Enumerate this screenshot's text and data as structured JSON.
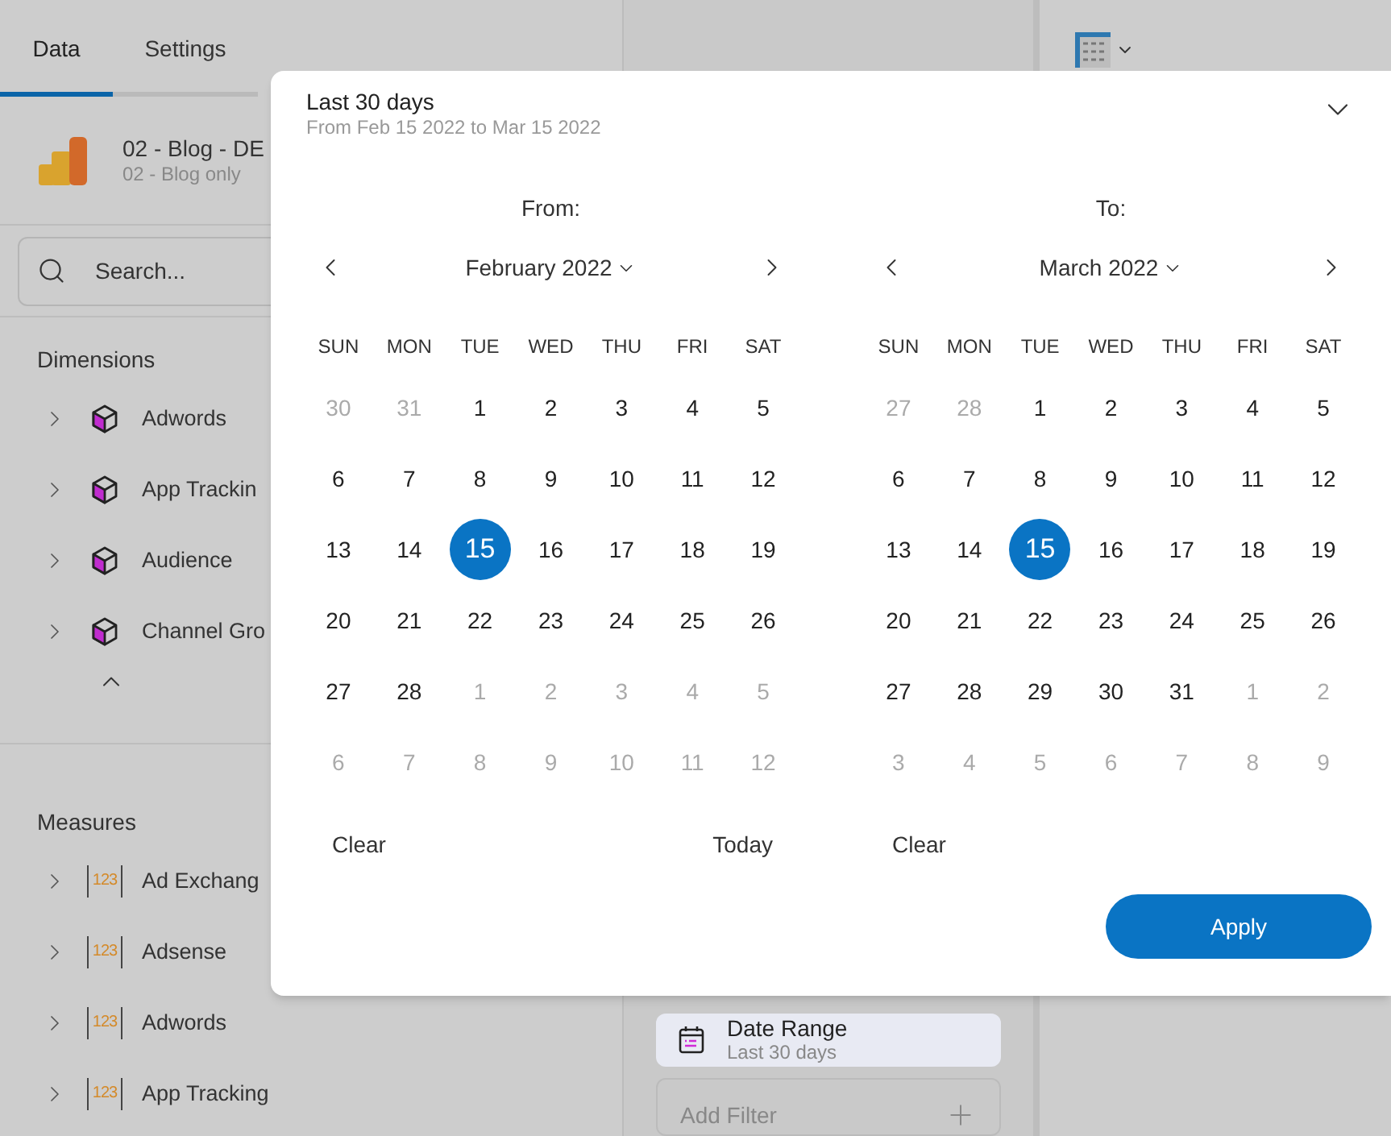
{
  "tabs": [
    {
      "label": "Data",
      "selected": true
    },
    {
      "label": "Settings",
      "selected": false
    }
  ],
  "source": {
    "name": "02 - Blog - DE",
    "subtitle": "02 - Blog only"
  },
  "search": {
    "placeholder": "Search..."
  },
  "sections": [
    {
      "title": "Dimensions",
      "kind": "dimension",
      "items": [
        {
          "label": "Adwords"
        },
        {
          "label": "App Trackin"
        },
        {
          "label": "Audience"
        },
        {
          "label": "Channel Gro"
        }
      ]
    },
    {
      "title": "Measures",
      "kind": "measure",
      "items": [
        {
          "label": "Ad Exchang",
          "icon_label": "123"
        },
        {
          "label": "Adsense",
          "icon_label": "123"
        },
        {
          "label": "Adwords",
          "icon_label": "123"
        },
        {
          "label": "App Tracking",
          "icon_label": "123"
        }
      ]
    }
  ],
  "filters": [
    {
      "kind": "date",
      "title": "Date Range",
      "subtitle": "Last 30 days",
      "selected": true
    },
    {
      "kind": "add",
      "placeholder": "Add Filter",
      "selected": false
    }
  ],
  "popup": {
    "title": "Last 30 days",
    "subtitle": "From Feb 15 2022 to Mar 15 2022",
    "calendars": [
      {
        "label": "From:",
        "month": "February 2022",
        "weekdays": [
          "SUN",
          "MON",
          "TUE",
          "WED",
          "THU",
          "FRI",
          "SAT"
        ],
        "buttons": [
          "Clear",
          "Today"
        ],
        "weeks": [
          [
            {
              "d": "30",
              "muted": true,
              "selected": false
            },
            {
              "d": "31",
              "muted": true,
              "selected": false
            },
            {
              "d": "1",
              "muted": false,
              "selected": false
            },
            {
              "d": "2",
              "muted": false,
              "selected": false
            },
            {
              "d": "3",
              "muted": false,
              "selected": false
            },
            {
              "d": "4",
              "muted": false,
              "selected": false
            },
            {
              "d": "5",
              "muted": false,
              "selected": false
            }
          ],
          [
            {
              "d": "6",
              "muted": false,
              "selected": false
            },
            {
              "d": "7",
              "muted": false,
              "selected": false
            },
            {
              "d": "8",
              "muted": false,
              "selected": false
            },
            {
              "d": "9",
              "muted": false,
              "selected": false
            },
            {
              "d": "10",
              "muted": false,
              "selected": false
            },
            {
              "d": "11",
              "muted": false,
              "selected": false
            },
            {
              "d": "12",
              "muted": false,
              "selected": false
            }
          ],
          [
            {
              "d": "13",
              "muted": false,
              "selected": false
            },
            {
              "d": "14",
              "muted": false,
              "selected": false
            },
            {
              "d": "15",
              "muted": false,
              "selected": true
            },
            {
              "d": "16",
              "muted": false,
              "selected": false
            },
            {
              "d": "17",
              "muted": false,
              "selected": false
            },
            {
              "d": "18",
              "muted": false,
              "selected": false
            },
            {
              "d": "19",
              "muted": false,
              "selected": false
            }
          ],
          [
            {
              "d": "20",
              "muted": false,
              "selected": false
            },
            {
              "d": "21",
              "muted": false,
              "selected": false
            },
            {
              "d": "22",
              "muted": false,
              "selected": false
            },
            {
              "d": "23",
              "muted": false,
              "selected": false
            },
            {
              "d": "24",
              "muted": false,
              "selected": false
            },
            {
              "d": "25",
              "muted": false,
              "selected": false
            },
            {
              "d": "26",
              "muted": false,
              "selected": false
            }
          ],
          [
            {
              "d": "27",
              "muted": false,
              "selected": false
            },
            {
              "d": "28",
              "muted": false,
              "selected": false
            },
            {
              "d": "1",
              "muted": true,
              "selected": false
            },
            {
              "d": "2",
              "muted": true,
              "selected": false
            },
            {
              "d": "3",
              "muted": true,
              "selected": false
            },
            {
              "d": "4",
              "muted": true,
              "selected": false
            },
            {
              "d": "5",
              "muted": true,
              "selected": false
            }
          ],
          [
            {
              "d": "6",
              "muted": true,
              "selected": false
            },
            {
              "d": "7",
              "muted": true,
              "selected": false
            },
            {
              "d": "8",
              "muted": true,
              "selected": false
            },
            {
              "d": "9",
              "muted": true,
              "selected": false
            },
            {
              "d": "10",
              "muted": true,
              "selected": false
            },
            {
              "d": "11",
              "muted": true,
              "selected": false
            },
            {
              "d": "12",
              "muted": true,
              "selected": false
            }
          ]
        ]
      },
      {
        "label": "To:",
        "month": "March 2022",
        "weekdays": [
          "SUN",
          "MON",
          "TUE",
          "WED",
          "THU",
          "FRI",
          "SAT"
        ],
        "buttons": [
          "Clear"
        ],
        "weeks": [
          [
            {
              "d": "27",
              "muted": true,
              "selected": false
            },
            {
              "d": "28",
              "muted": true,
              "selected": false
            },
            {
              "d": "1",
              "muted": false,
              "selected": false
            },
            {
              "d": "2",
              "muted": false,
              "selected": false
            },
            {
              "d": "3",
              "muted": false,
              "selected": false
            },
            {
              "d": "4",
              "muted": false,
              "selected": false
            },
            {
              "d": "5",
              "muted": false,
              "selected": false
            }
          ],
          [
            {
              "d": "6",
              "muted": false,
              "selected": false
            },
            {
              "d": "7",
              "muted": false,
              "selected": false
            },
            {
              "d": "8",
              "muted": false,
              "selected": false
            },
            {
              "d": "9",
              "muted": false,
              "selected": false
            },
            {
              "d": "10",
              "muted": false,
              "selected": false
            },
            {
              "d": "11",
              "muted": false,
              "selected": false
            },
            {
              "d": "12",
              "muted": false,
              "selected": false
            }
          ],
          [
            {
              "d": "13",
              "muted": false,
              "selected": false
            },
            {
              "d": "14",
              "muted": false,
              "selected": false
            },
            {
              "d": "15",
              "muted": false,
              "selected": true
            },
            {
              "d": "16",
              "muted": false,
              "selected": false
            },
            {
              "d": "17",
              "muted": false,
              "selected": false
            },
            {
              "d": "18",
              "muted": false,
              "selected": false
            },
            {
              "d": "19",
              "muted": false,
              "selected": false
            }
          ],
          [
            {
              "d": "20",
              "muted": false,
              "selected": false
            },
            {
              "d": "21",
              "muted": false,
              "selected": false
            },
            {
              "d": "22",
              "muted": false,
              "selected": false
            },
            {
              "d": "23",
              "muted": false,
              "selected": false
            },
            {
              "d": "24",
              "muted": false,
              "selected": false
            },
            {
              "d": "25",
              "muted": false,
              "selected": false
            },
            {
              "d": "26",
              "muted": false,
              "selected": false
            }
          ],
          [
            {
              "d": "27",
              "muted": false,
              "selected": false
            },
            {
              "d": "28",
              "muted": false,
              "selected": false
            },
            {
              "d": "29",
              "muted": false,
              "selected": false
            },
            {
              "d": "30",
              "muted": false,
              "selected": false
            },
            {
              "d": "31",
              "muted": false,
              "selected": false
            },
            {
              "d": "1",
              "muted": true,
              "selected": false
            },
            {
              "d": "2",
              "muted": true,
              "selected": false
            }
          ],
          [
            {
              "d": "3",
              "muted": true,
              "selected": false
            },
            {
              "d": "4",
              "muted": true,
              "selected": false
            },
            {
              "d": "5",
              "muted": true,
              "selected": false
            },
            {
              "d": "6",
              "muted": true,
              "selected": false
            },
            {
              "d": "7",
              "muted": true,
              "selected": false
            },
            {
              "d": "8",
              "muted": true,
              "selected": false
            },
            {
              "d": "9",
              "muted": true,
              "selected": false
            }
          ]
        ]
      }
    ],
    "apply": "Apply"
  }
}
